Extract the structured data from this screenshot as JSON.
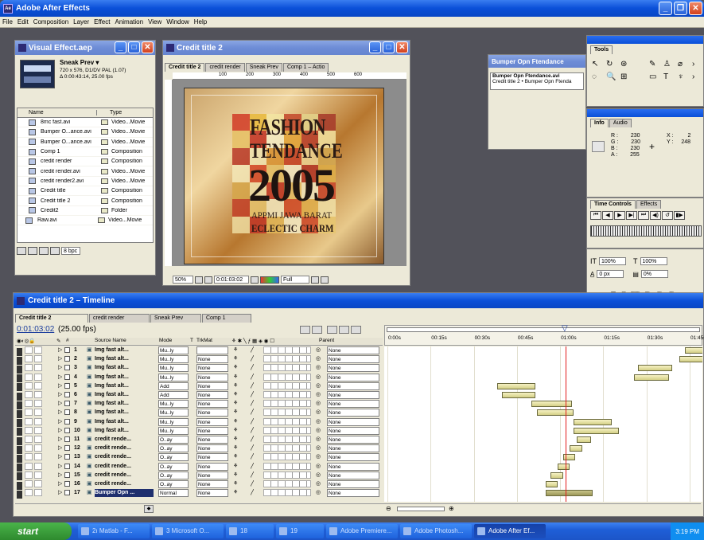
{
  "app": {
    "title": "Adobe After Effects"
  },
  "menu": [
    "File",
    "Edit",
    "Composition",
    "Layer",
    "Effect",
    "Animation",
    "View",
    "Window",
    "Help"
  ],
  "project": {
    "title": "Visual Effect.aep",
    "comp_name": "Sneak Prev ▾",
    "comp_info": "720 x 576, D1/DV PAL (1.07)",
    "comp_duration": "Δ 0:00:43:14, 25.00 fps",
    "col_name": "Name",
    "col_type": "Type",
    "items": [
      {
        "name": "8mc fast.avi",
        "type": "Video...Movie"
      },
      {
        "name": "Bumper O...ance.avi",
        "type": "Video...Movie"
      },
      {
        "name": "Bumper O...ance.avi",
        "type": "Video...Movie"
      },
      {
        "name": "Comp 1",
        "type": "Composition"
      },
      {
        "name": "credit render",
        "type": "Composition"
      },
      {
        "name": "credit render.avi",
        "type": "Video...Movie"
      },
      {
        "name": "credit render2.avi",
        "type": "Video...Movie"
      },
      {
        "name": "Credit title",
        "type": "Composition"
      },
      {
        "name": "Credit title 2",
        "type": "Composition"
      },
      {
        "name": "Credit2",
        "type": "Folder"
      },
      {
        "name": "Raw.avi",
        "type": "Video...Movie"
      }
    ],
    "bpc": "8 bpc"
  },
  "comp": {
    "title": "Credit title 2",
    "tabs": [
      "Credit title 2",
      "credit render",
      "Sneak Prev",
      "Comp 1 – Actio"
    ],
    "ruler": [
      "100",
      "200",
      "300",
      "400",
      "500",
      "600"
    ],
    "zoom": "50%",
    "timecode": "0:01:03:02",
    "resolution": "Full",
    "poster": [
      "FASHION",
      "TENDANCE",
      "2005",
      "APPMI JAWA BARAT",
      "ECLECTIC CHARM"
    ]
  },
  "bumper": {
    "title": "Bumper Opn Ftendance",
    "row1": "Bumper Opn Ftendance.avi",
    "row2": "Credit title 2 • Bumper Opn Ftenda"
  },
  "tools": {
    "title": "Tools"
  },
  "info": {
    "tabs": [
      "Info",
      "Audio"
    ],
    "r": "230",
    "g": "230",
    "b": "230",
    "a": "255",
    "x": "2",
    "y": "248"
  },
  "time_controls": {
    "tabs": [
      "Time Controls",
      "Effects"
    ]
  },
  "character": {
    "size": "100%",
    "size2": "100%",
    "tracking": "0 px",
    "baseline": "0%",
    "styles": [
      "T",
      "T",
      "TT",
      "Tr",
      "T¹",
      "T₁"
    ]
  },
  "timeline": {
    "title": "Credit title 2 – Timeline",
    "tabs": [
      "Credit title 2",
      "credit render",
      "Sneak Prev",
      "Comp 1"
    ],
    "timecode": "0:01:03:02",
    "fps": "(25.00 fps)",
    "headers": {
      "num": "#",
      "source": "Source Name",
      "mode": "Mode",
      "t": "T",
      "trkmat": "TrkMat",
      "parent": "Parent"
    },
    "ticks": [
      "0:00s",
      "00:15s",
      "00:30s",
      "00:45s",
      "01:00s",
      "01:15s",
      "01:30s",
      "01:45s"
    ],
    "layers": [
      {
        "num": "1",
        "name": "Img fast alt...",
        "mode": "Mu..ly",
        "trk": "",
        "parent": "None",
        "start": 0.855,
        "end": 0.965,
        "hl": false
      },
      {
        "num": "2",
        "name": "Img fast alt...",
        "mode": "Mu..ly",
        "trk": "None",
        "parent": "None",
        "start": 0.84,
        "end": 0.965,
        "hl": false
      },
      {
        "num": "3",
        "name": "Img fast alt...",
        "mode": "Mu..ly",
        "trk": "None",
        "parent": "None",
        "start": 0.72,
        "end": 0.82,
        "hl": false
      },
      {
        "num": "4",
        "name": "Img fast alt...",
        "mode": "Mu..ly",
        "trk": "None",
        "parent": "None",
        "start": 0.71,
        "end": 0.81,
        "hl": false
      },
      {
        "num": "5",
        "name": "Img fast alt...",
        "mode": "Add",
        "trk": "None",
        "parent": "None",
        "start": 0.315,
        "end": 0.425,
        "hl": false
      },
      {
        "num": "6",
        "name": "Img fast alt...",
        "mode": "Add",
        "trk": "None",
        "parent": "None",
        "start": 0.33,
        "end": 0.425,
        "hl": false
      },
      {
        "num": "7",
        "name": "Img fast alt...",
        "mode": "Mu..ly",
        "trk": "None",
        "parent": "None",
        "start": 0.415,
        "end": 0.53,
        "hl": false
      },
      {
        "num": "8",
        "name": "Img fast alt...",
        "mode": "Mu..ly",
        "trk": "None",
        "parent": "None",
        "start": 0.43,
        "end": 0.535,
        "hl": false
      },
      {
        "num": "9",
        "name": "Img fast alt...",
        "mode": "Mu..ly",
        "trk": "None",
        "parent": "None",
        "start": 0.535,
        "end": 0.645,
        "hl": false
      },
      {
        "num": "10",
        "name": "Img fast alt...",
        "mode": "Mu..ly",
        "trk": "None",
        "parent": "None",
        "start": 0.535,
        "end": 0.665,
        "hl": false
      },
      {
        "num": "11",
        "name": "credit rende...",
        "mode": "O..ay",
        "trk": "None",
        "parent": "None",
        "start": 0.545,
        "end": 0.585,
        "hl": false
      },
      {
        "num": "12",
        "name": "credit rende...",
        "mode": "O..ay",
        "trk": "None",
        "parent": "None",
        "start": 0.525,
        "end": 0.56,
        "hl": false
      },
      {
        "num": "13",
        "name": "credit rende...",
        "mode": "O..ay",
        "trk": "None",
        "parent": "None",
        "start": 0.505,
        "end": 0.54,
        "hl": false
      },
      {
        "num": "14",
        "name": "credit rende...",
        "mode": "O..ay",
        "trk": "None",
        "parent": "None",
        "start": 0.49,
        "end": 0.525,
        "hl": false
      },
      {
        "num": "15",
        "name": "credit rende...",
        "mode": "O..ay",
        "trk": "None",
        "parent": "None",
        "start": 0.47,
        "end": 0.505,
        "hl": false
      },
      {
        "num": "16",
        "name": "credit rende...",
        "mode": "O..ay",
        "trk": "None",
        "parent": "None",
        "start": 0.455,
        "end": 0.49,
        "hl": false
      },
      {
        "num": "17",
        "name": "Bumper Opn ...",
        "mode": "Normal",
        "trk": "None",
        "parent": "None",
        "start": 0.455,
        "end": 0.59,
        "hl": true
      }
    ],
    "current_time": 0.55
  },
  "taskbar": {
    "start": "start",
    "tasks": [
      "2ı Matlab - F...",
      "3 Microsoft O...",
      "18",
      "19",
      "Adobe Premiere...",
      "Adobe Photosh...",
      "Adobe After Ef..."
    ],
    "clock": "3:19 PM"
  }
}
